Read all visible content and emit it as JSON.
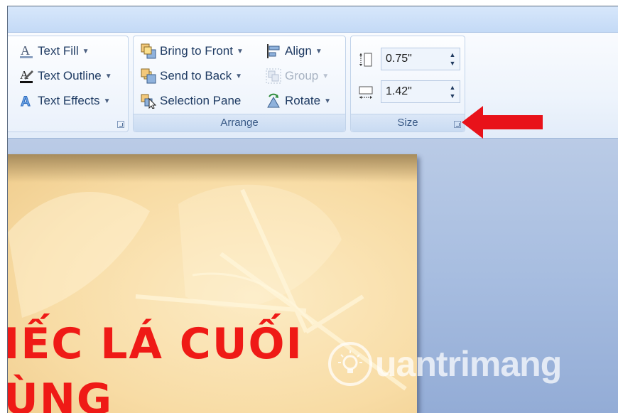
{
  "ribbon": {
    "wordart_group": {
      "items": [
        {
          "label": "Text Fill",
          "icon": "text-fill-icon"
        },
        {
          "label": "Text Outline",
          "icon": "text-outline-icon"
        },
        {
          "label": "Text Effects",
          "icon": "text-effects-icon"
        }
      ]
    },
    "arrange_group": {
      "label": "Arrange",
      "bring_to_front": "Bring to Front",
      "send_to_back": "Send to Back",
      "selection_pane": "Selection Pane",
      "align": "Align",
      "group": "Group",
      "rotate": "Rotate"
    },
    "size_group": {
      "label": "Size",
      "height_value": "0.75\"",
      "width_value": "1.42\""
    }
  },
  "slide": {
    "title_line1": "IẾC LÁ CUỐI",
    "title_line2": "ÙNG",
    "title_color": "#ef1a16"
  },
  "watermark": {
    "text": "uantrimang"
  },
  "colors": {
    "ribbon_text": "#1f3b63",
    "group_label": "#3a5a86",
    "annotation_arrow": "#e8121a",
    "slide_bg": "#f8dca5"
  }
}
